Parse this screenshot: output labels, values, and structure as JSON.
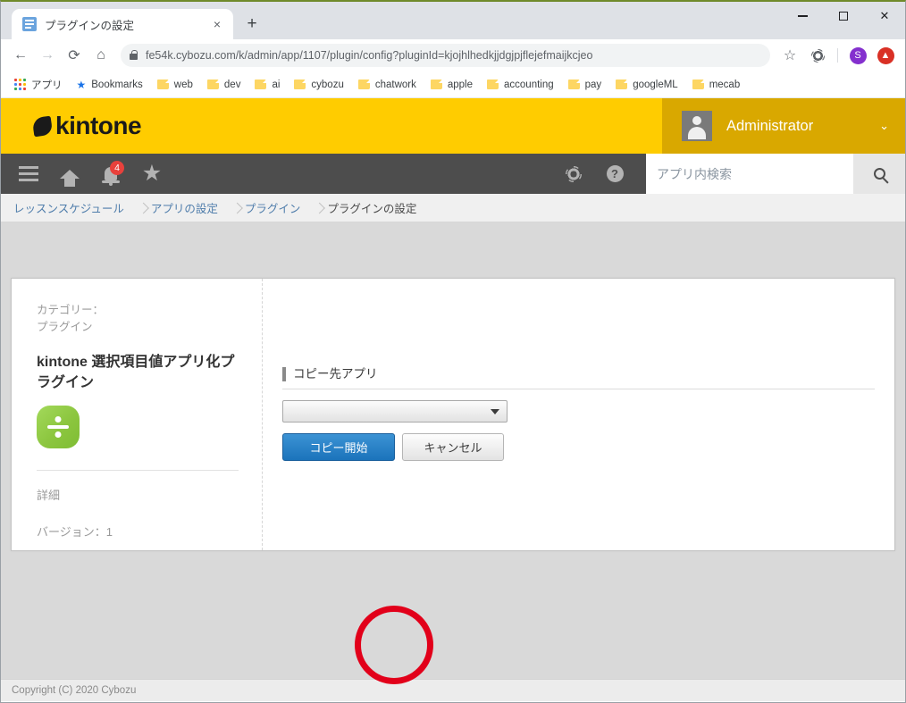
{
  "browser": {
    "tab": {
      "title": "プラグインの設定",
      "favicon": "document-icon",
      "close_label": "×"
    },
    "new_tab_label": "+",
    "window_controls": {
      "minimize": "–",
      "maximize": "□",
      "close": "✕"
    },
    "nav": {
      "back": "←",
      "forward": "→",
      "reload": "⟳",
      "home": "⌂"
    },
    "omnibox": {
      "url": "fe54k.cybozu.com/k/admin/app/1107/plugin/config?pluginId=kjojhlhedkjjdgjpjflejefmaijkcjeo",
      "lock_icon": "lock-icon",
      "bookmark_icon": "star-outline-icon"
    },
    "toolbar_right": {
      "extension_icon": "puzzle-gear-icon",
      "profile_initial": "S",
      "update_icon": "arrow-up-icon"
    },
    "bookmarks": [
      {
        "label": "アプリ",
        "icon": "apps-grid-icon"
      },
      {
        "label": "Bookmarks",
        "icon": "star-icon"
      },
      {
        "label": "web",
        "icon": "folder-icon"
      },
      {
        "label": "dev",
        "icon": "folder-icon"
      },
      {
        "label": "ai",
        "icon": "folder-icon"
      },
      {
        "label": "cybozu",
        "icon": "folder-icon"
      },
      {
        "label": "chatwork",
        "icon": "folder-icon"
      },
      {
        "label": "apple",
        "icon": "folder-icon"
      },
      {
        "label": "accounting",
        "icon": "folder-icon"
      },
      {
        "label": "pay",
        "icon": "folder-icon"
      },
      {
        "label": "googleML",
        "icon": "folder-icon"
      },
      {
        "label": "mecab",
        "icon": "folder-icon"
      }
    ]
  },
  "kintone": {
    "brand": {
      "name": "kintone",
      "color": "#ffcc00"
    },
    "user": {
      "name": "Administrator",
      "avatar": "user-avatar",
      "caret": "⌄"
    },
    "nav_icons": [
      {
        "name": "hamburger-menu-icon"
      },
      {
        "name": "home-icon"
      },
      {
        "name": "notification-bell-icon",
        "badge": "4"
      },
      {
        "name": "favorite-star-icon"
      }
    ],
    "nav_right_icons": [
      {
        "name": "gear-icon"
      },
      {
        "name": "help-icon",
        "glyph": "?"
      }
    ],
    "search": {
      "placeholder": "アプリ内検索",
      "value": "",
      "button_icon": "search-icon"
    },
    "breadcrumbs": [
      {
        "label": "レッスンスケジュール",
        "current": false
      },
      {
        "label": "アプリの設定",
        "current": false
      },
      {
        "label": "プラグイン",
        "current": false
      },
      {
        "label": "プラグインの設定",
        "current": true
      }
    ],
    "plugin": {
      "category_label": "カテゴリー：",
      "category_value": "プラグイン",
      "title": "kintone 選択項目値アプリ化プラグイン",
      "icon": "division-sign-icon",
      "icon_color": "#8cc63f",
      "detail_heading": "詳細",
      "version_text": "バージョン：1"
    },
    "form": {
      "field_label": "コピー先アプリ",
      "select_value": "",
      "select_arrow_icon": "chevron-down-icon",
      "primary_button": "コピー開始",
      "secondary_button": "キャンセル"
    },
    "annotation": {
      "shape": "circle",
      "color": "#e2001a"
    },
    "footer": {
      "copyright": "Copyright (C) 2020 Cybozu"
    }
  }
}
